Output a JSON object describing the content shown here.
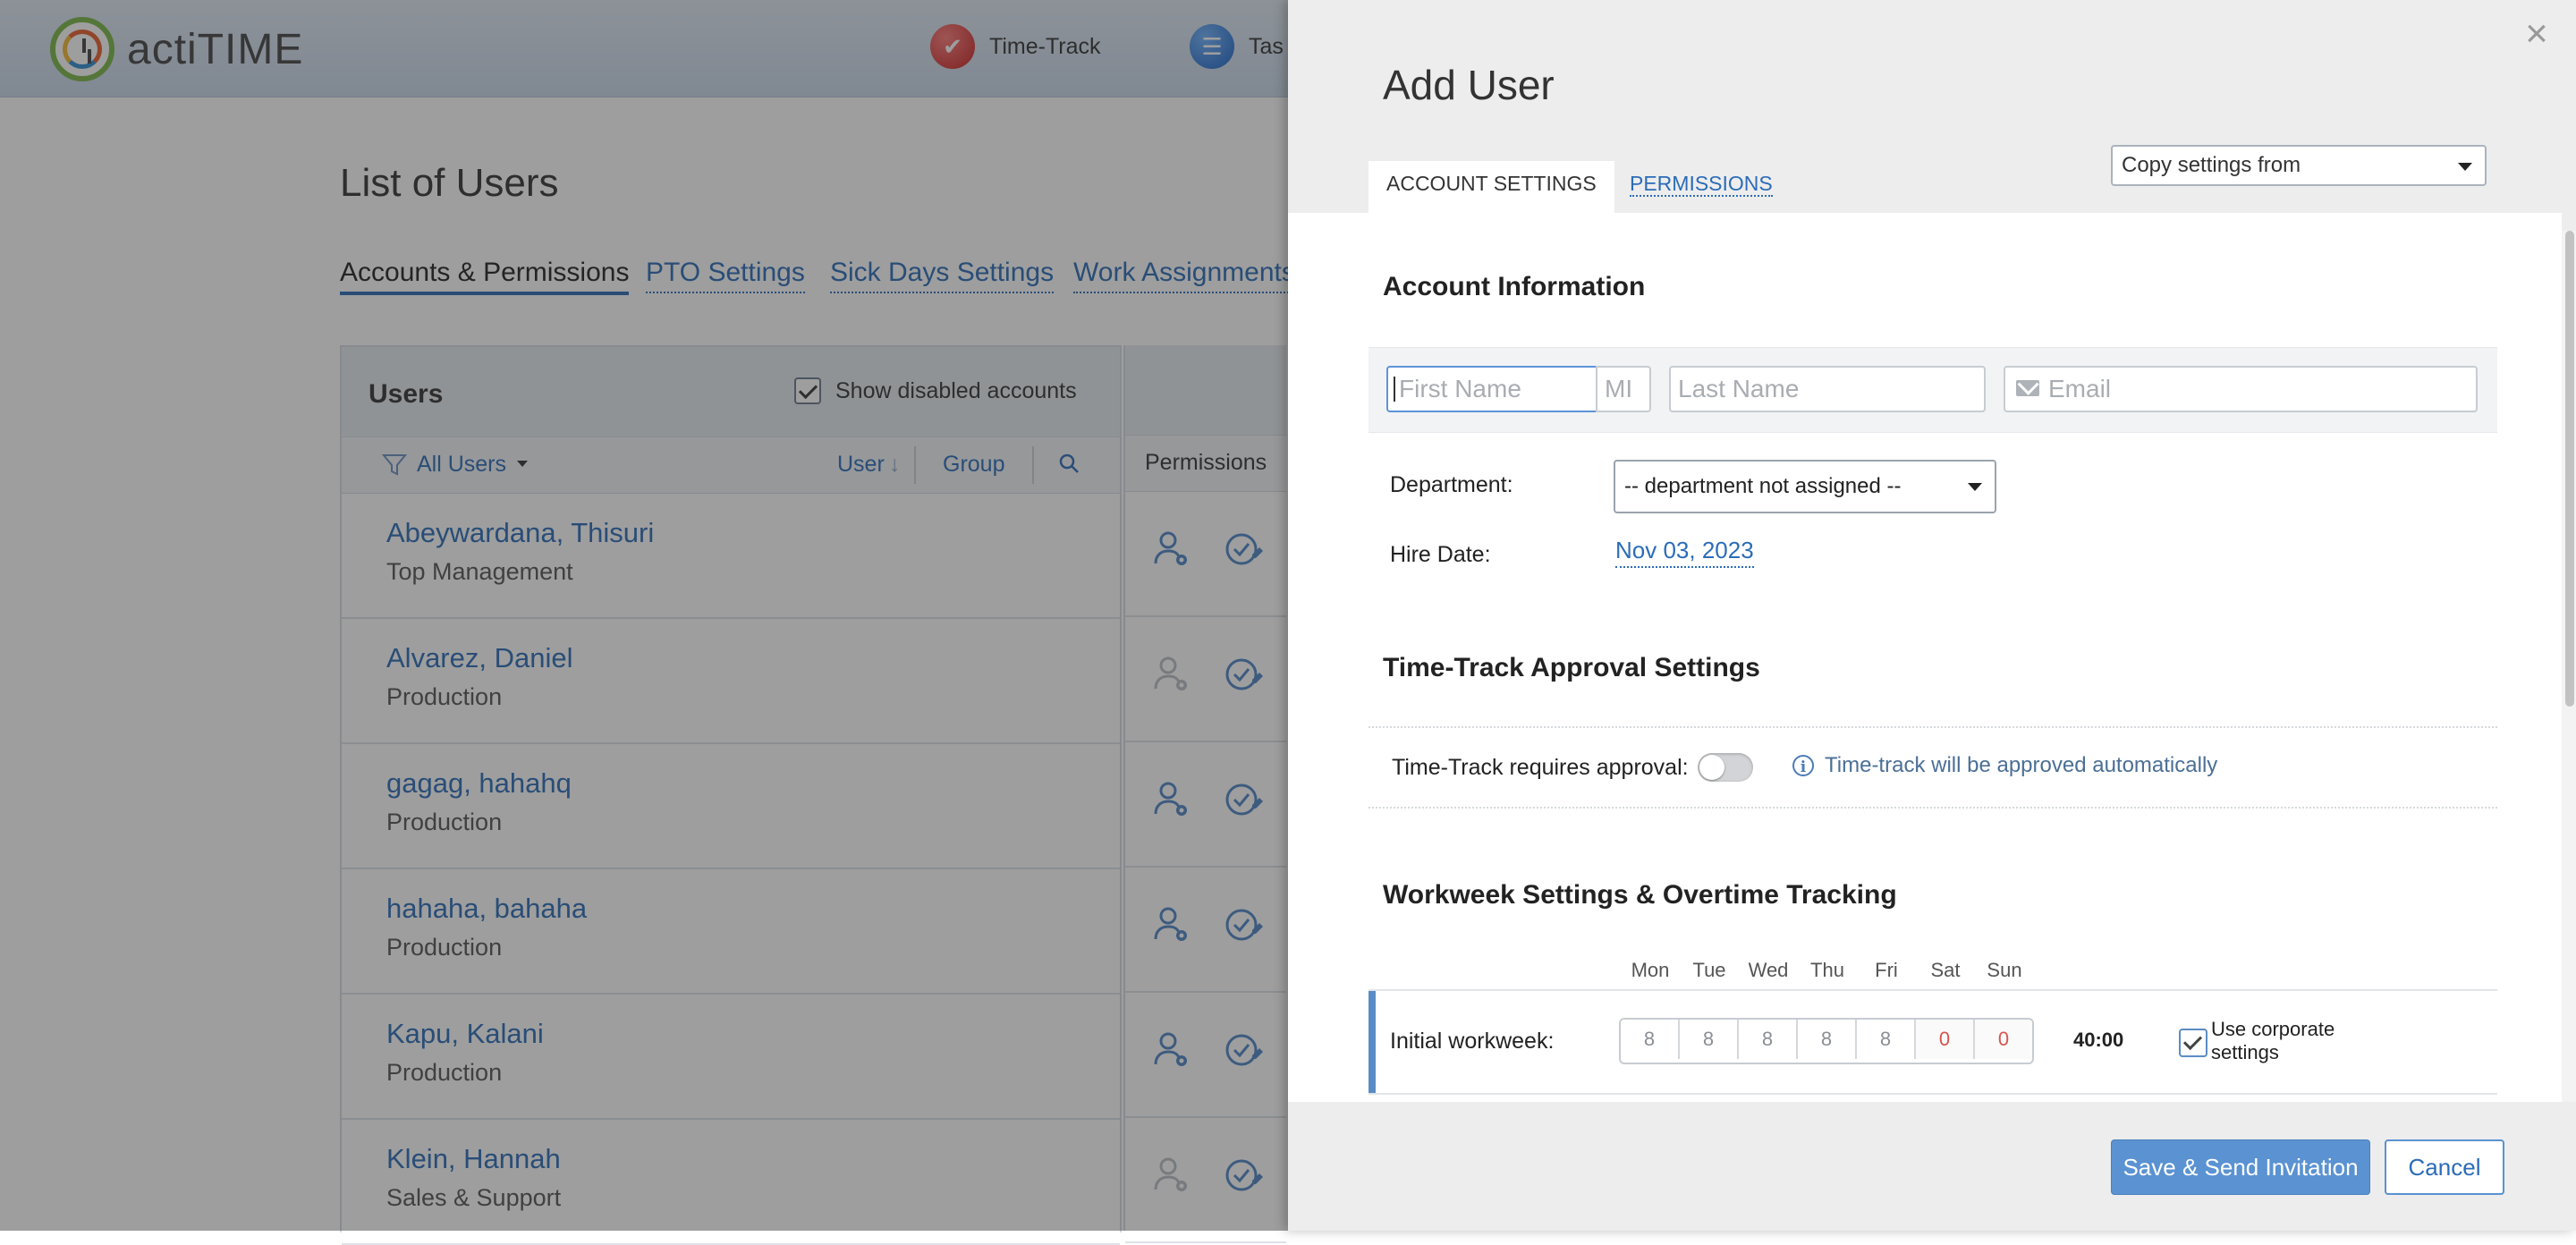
{
  "app": {
    "logo_text": "actiTIME",
    "nav": [
      {
        "label": "Time-Track",
        "icon": "checkmark-icon"
      },
      {
        "label": "Tas",
        "icon": "task-list-icon"
      }
    ]
  },
  "page": {
    "title": "List of Users",
    "tabs": [
      "Accounts & Permissions",
      "PTO Settings",
      "Sick Days Settings",
      "Work Assignments"
    ],
    "active_tab": "Accounts & Permissions"
  },
  "users_panel": {
    "title": "Users",
    "show_disabled_label": "Show disabled accounts",
    "show_disabled_checked": true,
    "filter_label": "All Users",
    "sort_user": "User",
    "sort_group": "Group",
    "permissions_header": "Permissions",
    "users": [
      {
        "name": "Abeywardana, Thisuri",
        "department": "Top Management",
        "user_icon_active": true
      },
      {
        "name": "Alvarez, Daniel",
        "department": "Production",
        "user_icon_active": false
      },
      {
        "name": "gagag, hahahq",
        "department": "Production",
        "user_icon_active": true
      },
      {
        "name": "hahaha, bahaha",
        "department": "Production",
        "user_icon_active": true
      },
      {
        "name": "Kapu, Kalani",
        "department": "Production",
        "user_icon_active": true
      },
      {
        "name": "Klein, Hannah",
        "department": "Sales & Support",
        "user_icon_active": false
      }
    ]
  },
  "dialog": {
    "title": "Add User",
    "tabs": {
      "account": "ACCOUNT SETTINGS",
      "permissions": "PERMISSIONS"
    },
    "copy_settings": "Copy settings from",
    "account_info": {
      "heading": "Account Information",
      "first_name_placeholder": "First Name",
      "mi_placeholder": "MI",
      "last_name_placeholder": "Last Name",
      "email_placeholder": "Email",
      "department_label": "Department:",
      "department_value": "-- department not assigned --",
      "hire_date_label": "Hire Date:",
      "hire_date_value": "Nov 03, 2023"
    },
    "approval": {
      "heading": "Time-Track Approval Settings",
      "requires_label": "Time-Track requires approval:",
      "requires_on": false,
      "note": "Time-track will be approved automatically"
    },
    "workweek": {
      "heading": "Workweek Settings & Overtime Tracking",
      "days": [
        "Mon",
        "Tue",
        "Wed",
        "Thu",
        "Fri",
        "Sat",
        "Sun"
      ],
      "initial_label": "Initial workweek:",
      "hours": [
        "8",
        "8",
        "8",
        "8",
        "8",
        "0",
        "0"
      ],
      "total": "40:00",
      "use_corporate_label": "Use corporate settings",
      "use_corporate_checked": true
    },
    "buttons": {
      "save": "Save & Send Invitation",
      "cancel": "Cancel"
    }
  },
  "colors": {
    "accent": "#2b6cb8",
    "primary_button": "#5a92d2",
    "weekend_hours": "#d9534f"
  }
}
